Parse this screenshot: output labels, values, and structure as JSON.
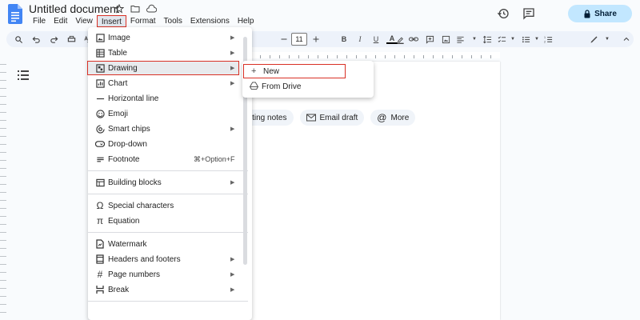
{
  "app": {
    "title": "Untitled document",
    "menu": [
      "File",
      "Edit",
      "View",
      "Insert",
      "Format",
      "Tools",
      "Extensions",
      "Help"
    ],
    "active_menu": "Insert",
    "share_label": "Share",
    "accent": "#c2e7ff",
    "highlight": "#d93025"
  },
  "toolbar": {
    "font_size": "11"
  },
  "insert_menu": {
    "items": [
      {
        "label": "Image",
        "icon": "image-icon",
        "submenu": true
      },
      {
        "label": "Table",
        "icon": "table-icon",
        "submenu": true
      },
      {
        "label": "Drawing",
        "icon": "drawing-icon",
        "submenu": true
      },
      {
        "label": "Chart",
        "icon": "chart-icon",
        "submenu": true
      },
      {
        "label": "Horizontal line",
        "icon": "horizontal-line-icon",
        "submenu": false
      },
      {
        "label": "Emoji",
        "icon": "emoji-icon",
        "submenu": false
      },
      {
        "label": "Smart chips",
        "icon": "smart-chips-icon",
        "submenu": true
      },
      {
        "label": "Drop-down",
        "icon": "dropdown-icon",
        "submenu": false
      },
      {
        "label": "Footnote",
        "icon": "footnote-icon",
        "submenu": false,
        "shortcut": "⌘+Option+F"
      },
      {
        "label": "Building blocks",
        "icon": "building-blocks-icon",
        "submenu": true
      },
      {
        "label": "Special characters",
        "icon": "omega-icon",
        "submenu": false
      },
      {
        "label": "Equation",
        "icon": "pi-icon",
        "submenu": false
      },
      {
        "label": "Watermark",
        "icon": "watermark-icon",
        "submenu": false
      },
      {
        "label": "Headers and footers",
        "icon": "headers-footers-icon",
        "submenu": true
      },
      {
        "label": "Page numbers",
        "icon": "hash-icon",
        "submenu": true
      },
      {
        "label": "Break",
        "icon": "break-icon",
        "submenu": true
      }
    ]
  },
  "drawing_submenu": {
    "items": [
      {
        "label": "New",
        "icon": "plus-icon"
      },
      {
        "label": "From Drive",
        "icon": "drive-icon"
      }
    ]
  },
  "chips": [
    "eeting notes",
    "Email draft",
    "More"
  ]
}
